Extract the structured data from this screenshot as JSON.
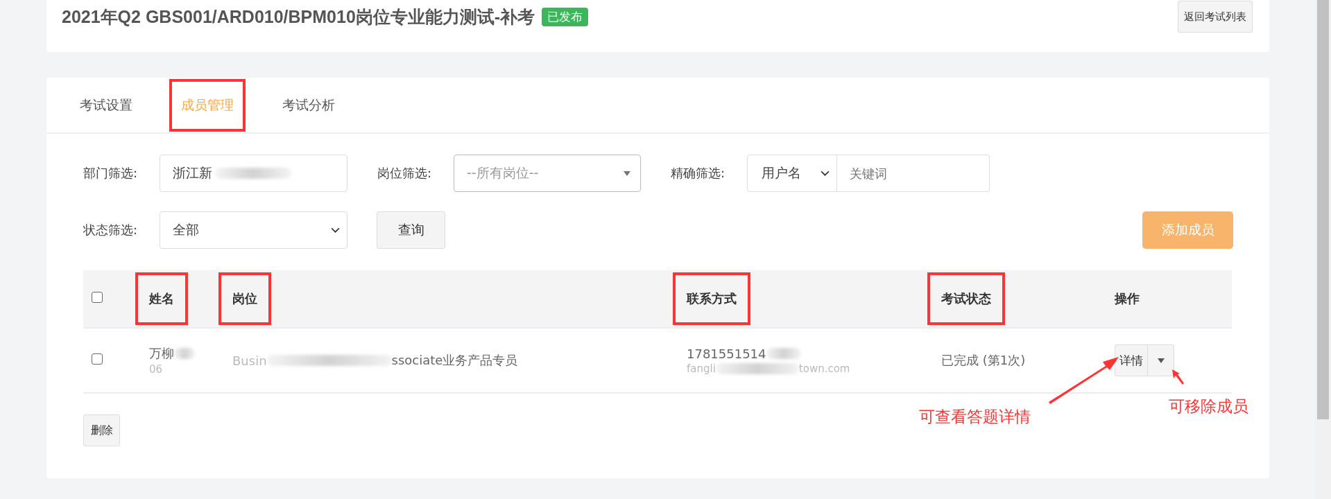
{
  "header": {
    "title": "2021年Q2 GBS001/ARD010/BPM010岗位专业能力测试-补考",
    "badge": "已发布",
    "back_button": "返回考试列表"
  },
  "tabs": [
    {
      "label": "考试设置",
      "selected": false,
      "highlighted": false
    },
    {
      "label": "成员管理",
      "selected": true,
      "highlighted": true
    },
    {
      "label": "考试分析",
      "selected": false,
      "highlighted": false
    }
  ],
  "filters": {
    "department": {
      "label": "部门筛选:",
      "value": "浙江新"
    },
    "position": {
      "label": "岗位筛选:",
      "placeholder": "--所有岗位--"
    },
    "exact": {
      "label": "精确筛选:",
      "field": "用户名",
      "placeholder": "关键词"
    },
    "status": {
      "label": "状态筛选:",
      "value": "全部"
    },
    "query_button": "查询",
    "add_button": "添加成员"
  },
  "table": {
    "all_checked": false,
    "columns": [
      {
        "label": "姓名",
        "highlighted": true
      },
      {
        "label": "岗位",
        "highlighted": true
      },
      {
        "label": "联系方式",
        "highlighted": true
      },
      {
        "label": "考试状态",
        "highlighted": true
      },
      {
        "label": "操作",
        "highlighted": false
      }
    ],
    "rows": [
      {
        "checked": false,
        "name": "万柳",
        "name_sub": "06",
        "position": "Busin",
        "position_tail": "ssociate业务产品专员",
        "phone": "1781551514",
        "email": "fangli",
        "email_tail": "town.com",
        "status": "已完成 (第1次)",
        "detail_button": "详情"
      }
    ]
  },
  "delete_button": "删除",
  "annotations": [
    {
      "text": "可查看答题详情"
    },
    {
      "text": "可移除成员"
    }
  ]
}
